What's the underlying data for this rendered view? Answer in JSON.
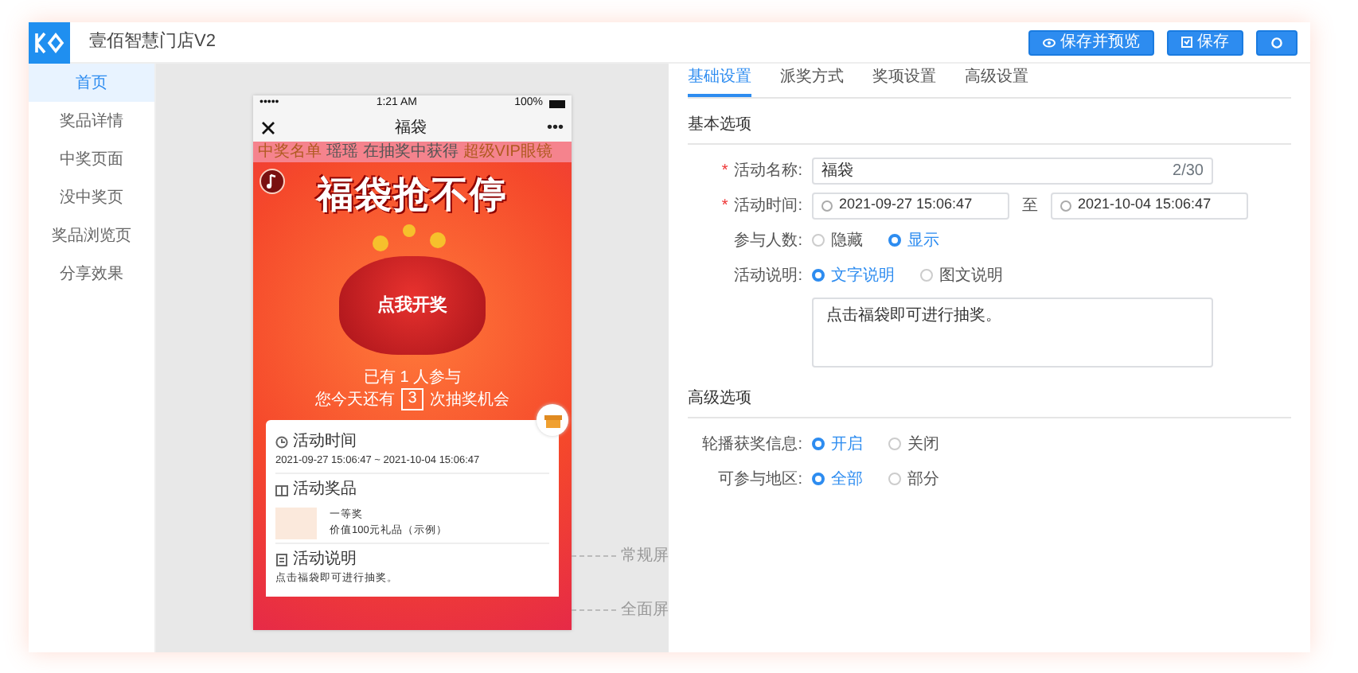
{
  "app": {
    "title": "壹佰智慧门店V2"
  },
  "header_buttons": [
    {
      "kind": "preview",
      "label": "保存并预览"
    },
    {
      "kind": "save",
      "label": "保存"
    },
    {
      "kind": "settings"
    }
  ],
  "sidebar": {
    "items": [
      {
        "label": "首页",
        "selected": true
      },
      {
        "label": "奖品详情",
        "selected": false
      },
      {
        "label": "中奖页面",
        "selected": false
      },
      {
        "label": "没中奖页",
        "selected": false
      },
      {
        "label": "奖品浏览页",
        "selected": false
      },
      {
        "label": "分享效果",
        "selected": false
      }
    ]
  },
  "phone": {
    "status": {
      "signal": "•••••",
      "time": "1:21 AM",
      "battery": "100%"
    },
    "nav": {
      "title": "福袋",
      "more": "•••"
    },
    "marquee": {
      "label": "中奖名单",
      "message": "瑶瑶 在抽奖中获得",
      "prize": "超级VIP眼镜"
    },
    "poster": {
      "headline": "福袋抢不停",
      "bag_label": "点我开奖",
      "participants": "已有 1 人参与",
      "chances_prefix": "您今天还有",
      "chances": "3",
      "chances_suffix": "次抽奖机会"
    },
    "info": [
      {
        "kind": "time",
        "title": "活动时间",
        "text": "2021-09-27 15:06:47 ~ 2021-10-04 15:06:47"
      },
      {
        "kind": "prize",
        "title": "活动奖品",
        "prize_name": "一等奖",
        "prize_desc": "价值100元礼品（示例）"
      },
      {
        "kind": "note",
        "title": "活动说明",
        "text": "点击福袋即可进行抽奖。"
      }
    ]
  },
  "screen_markers": [
    "常规屏",
    "全面屏"
  ],
  "form": {
    "tabs": [
      {
        "label": "基础设置",
        "selected": true
      },
      {
        "label": "派奖方式",
        "selected": false
      },
      {
        "label": "奖项设置",
        "selected": false
      },
      {
        "label": "高级设置",
        "selected": false
      }
    ],
    "sections": [
      {
        "title": "基本选项",
        "fields": [
          {
            "kind": "text",
            "label": "活动名称:",
            "required_mark": "*",
            "value": "福袋",
            "counter": "2/30"
          },
          {
            "kind": "daterange",
            "label": "活动时间:",
            "required_mark": "*",
            "start": "2021-09-27 15:06:47",
            "separator": "至",
            "end": "2021-10-04 15:06:47"
          },
          {
            "kind": "radio",
            "label": "参与人数:",
            "options": [
              {
                "label": "隐藏",
                "selected": false
              },
              {
                "label": "显示",
                "selected": true
              }
            ]
          },
          {
            "kind": "radio",
            "label": "活动说明:",
            "options": [
              {
                "label": "文字说明",
                "selected": true
              },
              {
                "label": "图文说明",
                "selected": false
              }
            ]
          },
          {
            "kind": "textarea",
            "value": "点击福袋即可进行抽奖。"
          }
        ]
      },
      {
        "title": "高级选项",
        "fields": [
          {
            "kind": "radio",
            "label": "轮播获奖信息:",
            "options": [
              {
                "label": "开启",
                "selected": true
              },
              {
                "label": "关闭",
                "selected": false
              }
            ]
          },
          {
            "kind": "radio",
            "label": "可参与地区:",
            "options": [
              {
                "label": "全部",
                "selected": true
              },
              {
                "label": "部分",
                "selected": false
              }
            ]
          }
        ]
      }
    ]
  }
}
